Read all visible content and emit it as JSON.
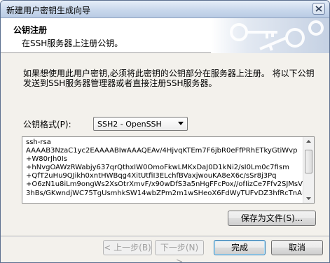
{
  "window": {
    "title": "新建用户密钥生成向导"
  },
  "header": {
    "title": "公钥注册",
    "subtitle": "在SSH服务器上注册公钥。"
  },
  "main": {
    "description": "如果想使用此用户密钥,必须将此密钥的公钥部分在服务器上注册。 将以下公钥发送到SSH服务器管理器或者直接注册SSH服务器。",
    "format_label": "公钥格式(P):",
    "format_selected": "SSH2 - OpenSSH",
    "public_key_lines": [
      "ssh-rsa",
      "AAAAB3NzaC1yc2EAAAABIwAAAQEAv/4HjvqKTEm7F6jbR0eFfPRhETkyGtiWvp",
      "+W80rJh0Is",
      "+hNvgOAWzRWabjy637qrQthxIW0OmoFkwLMKxDaJ0D1kNi2/sI0Lm0c7fIsm",
      "+QfT2uHu9QJikh0xntHWBqg4XitUtfiI3ELchfBVaxjwouKA8eX6c/sSr8j3Pq",
      "+O6zN1u8iLm9ongWs2XsOtrXmvF/x90wDfS3a5nHgFFcPox//ofIizCe7Ffv2SJMsV",
      "3hBs/GKwndjWC75TgUsmhkSW14wbZPm2m1wSHeoX6FdWyTUFvDZ3hfRcTnAiEx"
    ],
    "save_button": "保存为文件(S)..."
  },
  "footer": {
    "back_button": "< 上一步(B)",
    "next_button": "下一步(N) >",
    "finish_button": "完成",
    "cancel_button": "取消"
  }
}
